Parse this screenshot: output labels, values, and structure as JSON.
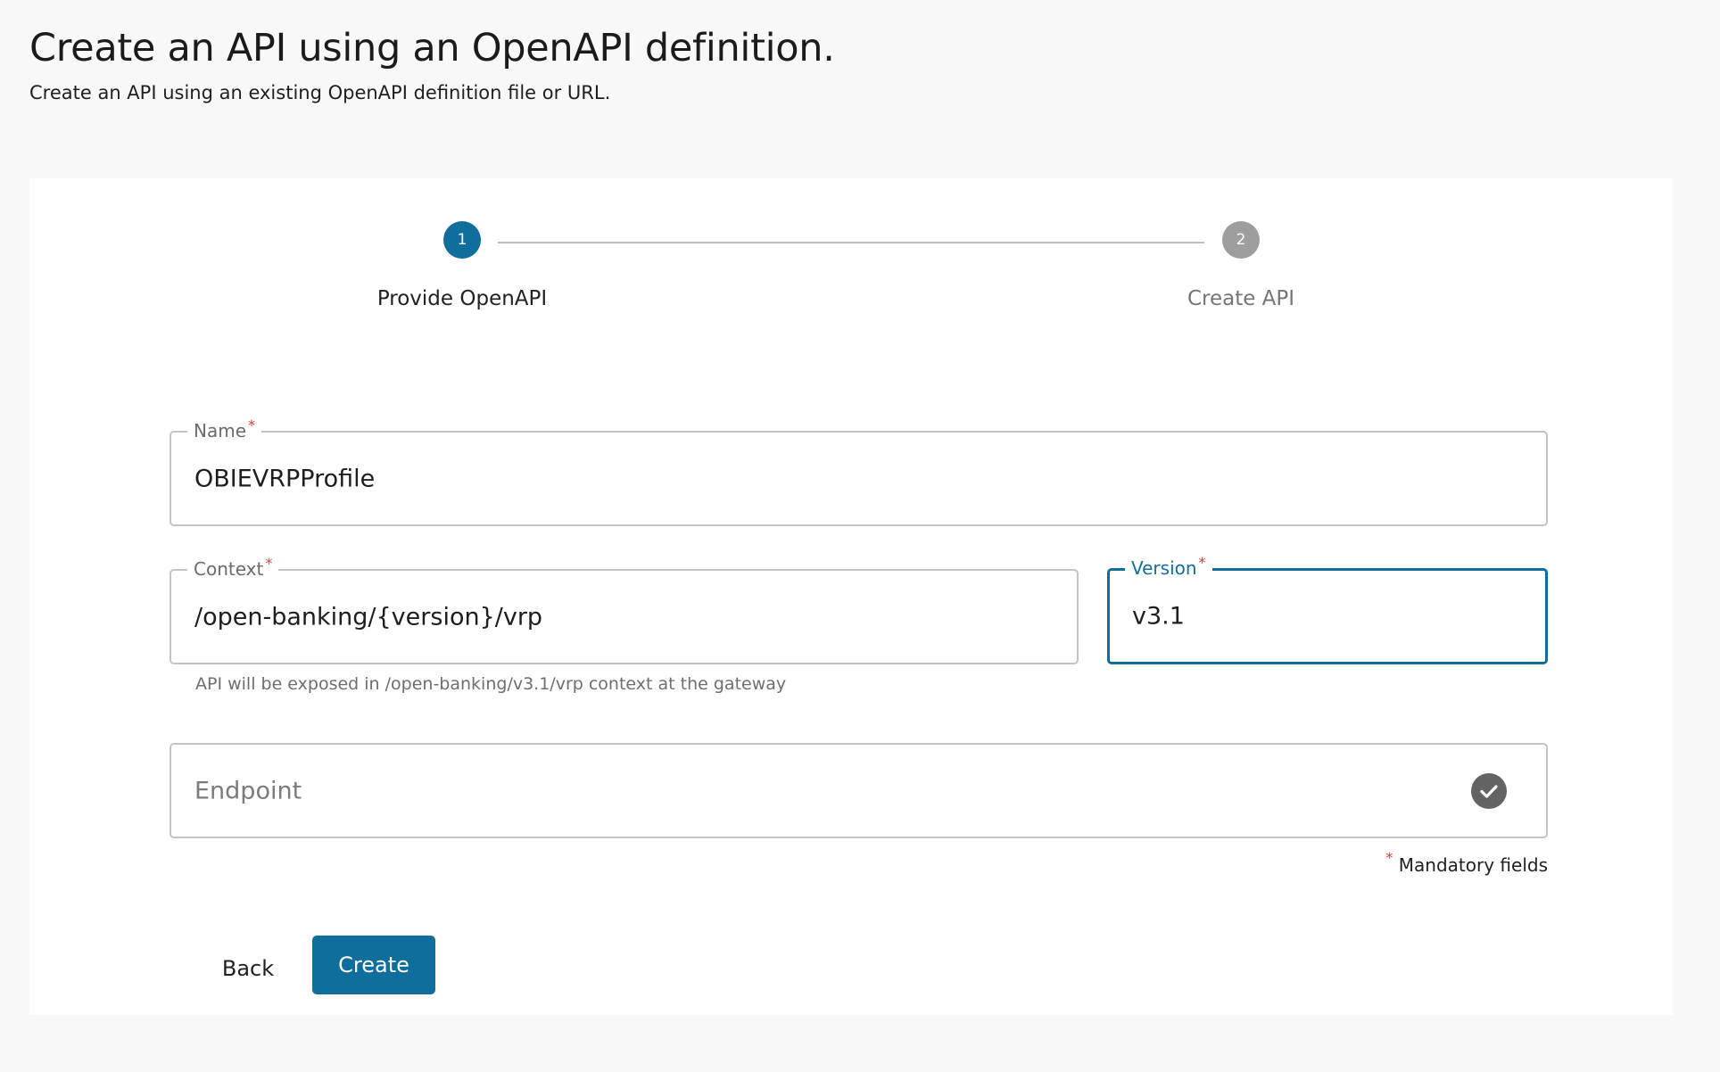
{
  "header": {
    "title": "Create an API using an OpenAPI definition.",
    "subtitle": "Create an API using an existing OpenAPI definition file or URL."
  },
  "stepper": {
    "steps": [
      {
        "number": "1",
        "label": "Provide OpenAPI",
        "state": "active"
      },
      {
        "number": "2",
        "label": "Create API",
        "state": "inactive"
      }
    ]
  },
  "form": {
    "name": {
      "label": "Name",
      "required_mark": "*",
      "value": "OBIEVRPProfile"
    },
    "context": {
      "label": "Context",
      "required_mark": "*",
      "value": "/open-banking/{version}/vrp",
      "helper": "API will be exposed in /open-banking/v3.1/vrp context at the gateway"
    },
    "version": {
      "label": "Version",
      "required_mark": "*",
      "value": "v3.1"
    },
    "endpoint": {
      "placeholder": "Endpoint",
      "value": ""
    },
    "mandatory_mark": "*",
    "mandatory_text": "Mandatory fields"
  },
  "actions": {
    "back_label": "Back",
    "create_label": "Create"
  },
  "colors": {
    "primary": "#0f6e9c",
    "required": "#e53935",
    "step_inactive": "#9e9e9e",
    "background": "#f8f8f8"
  },
  "icons": {
    "endpoint_status": "check-circle-icon"
  }
}
